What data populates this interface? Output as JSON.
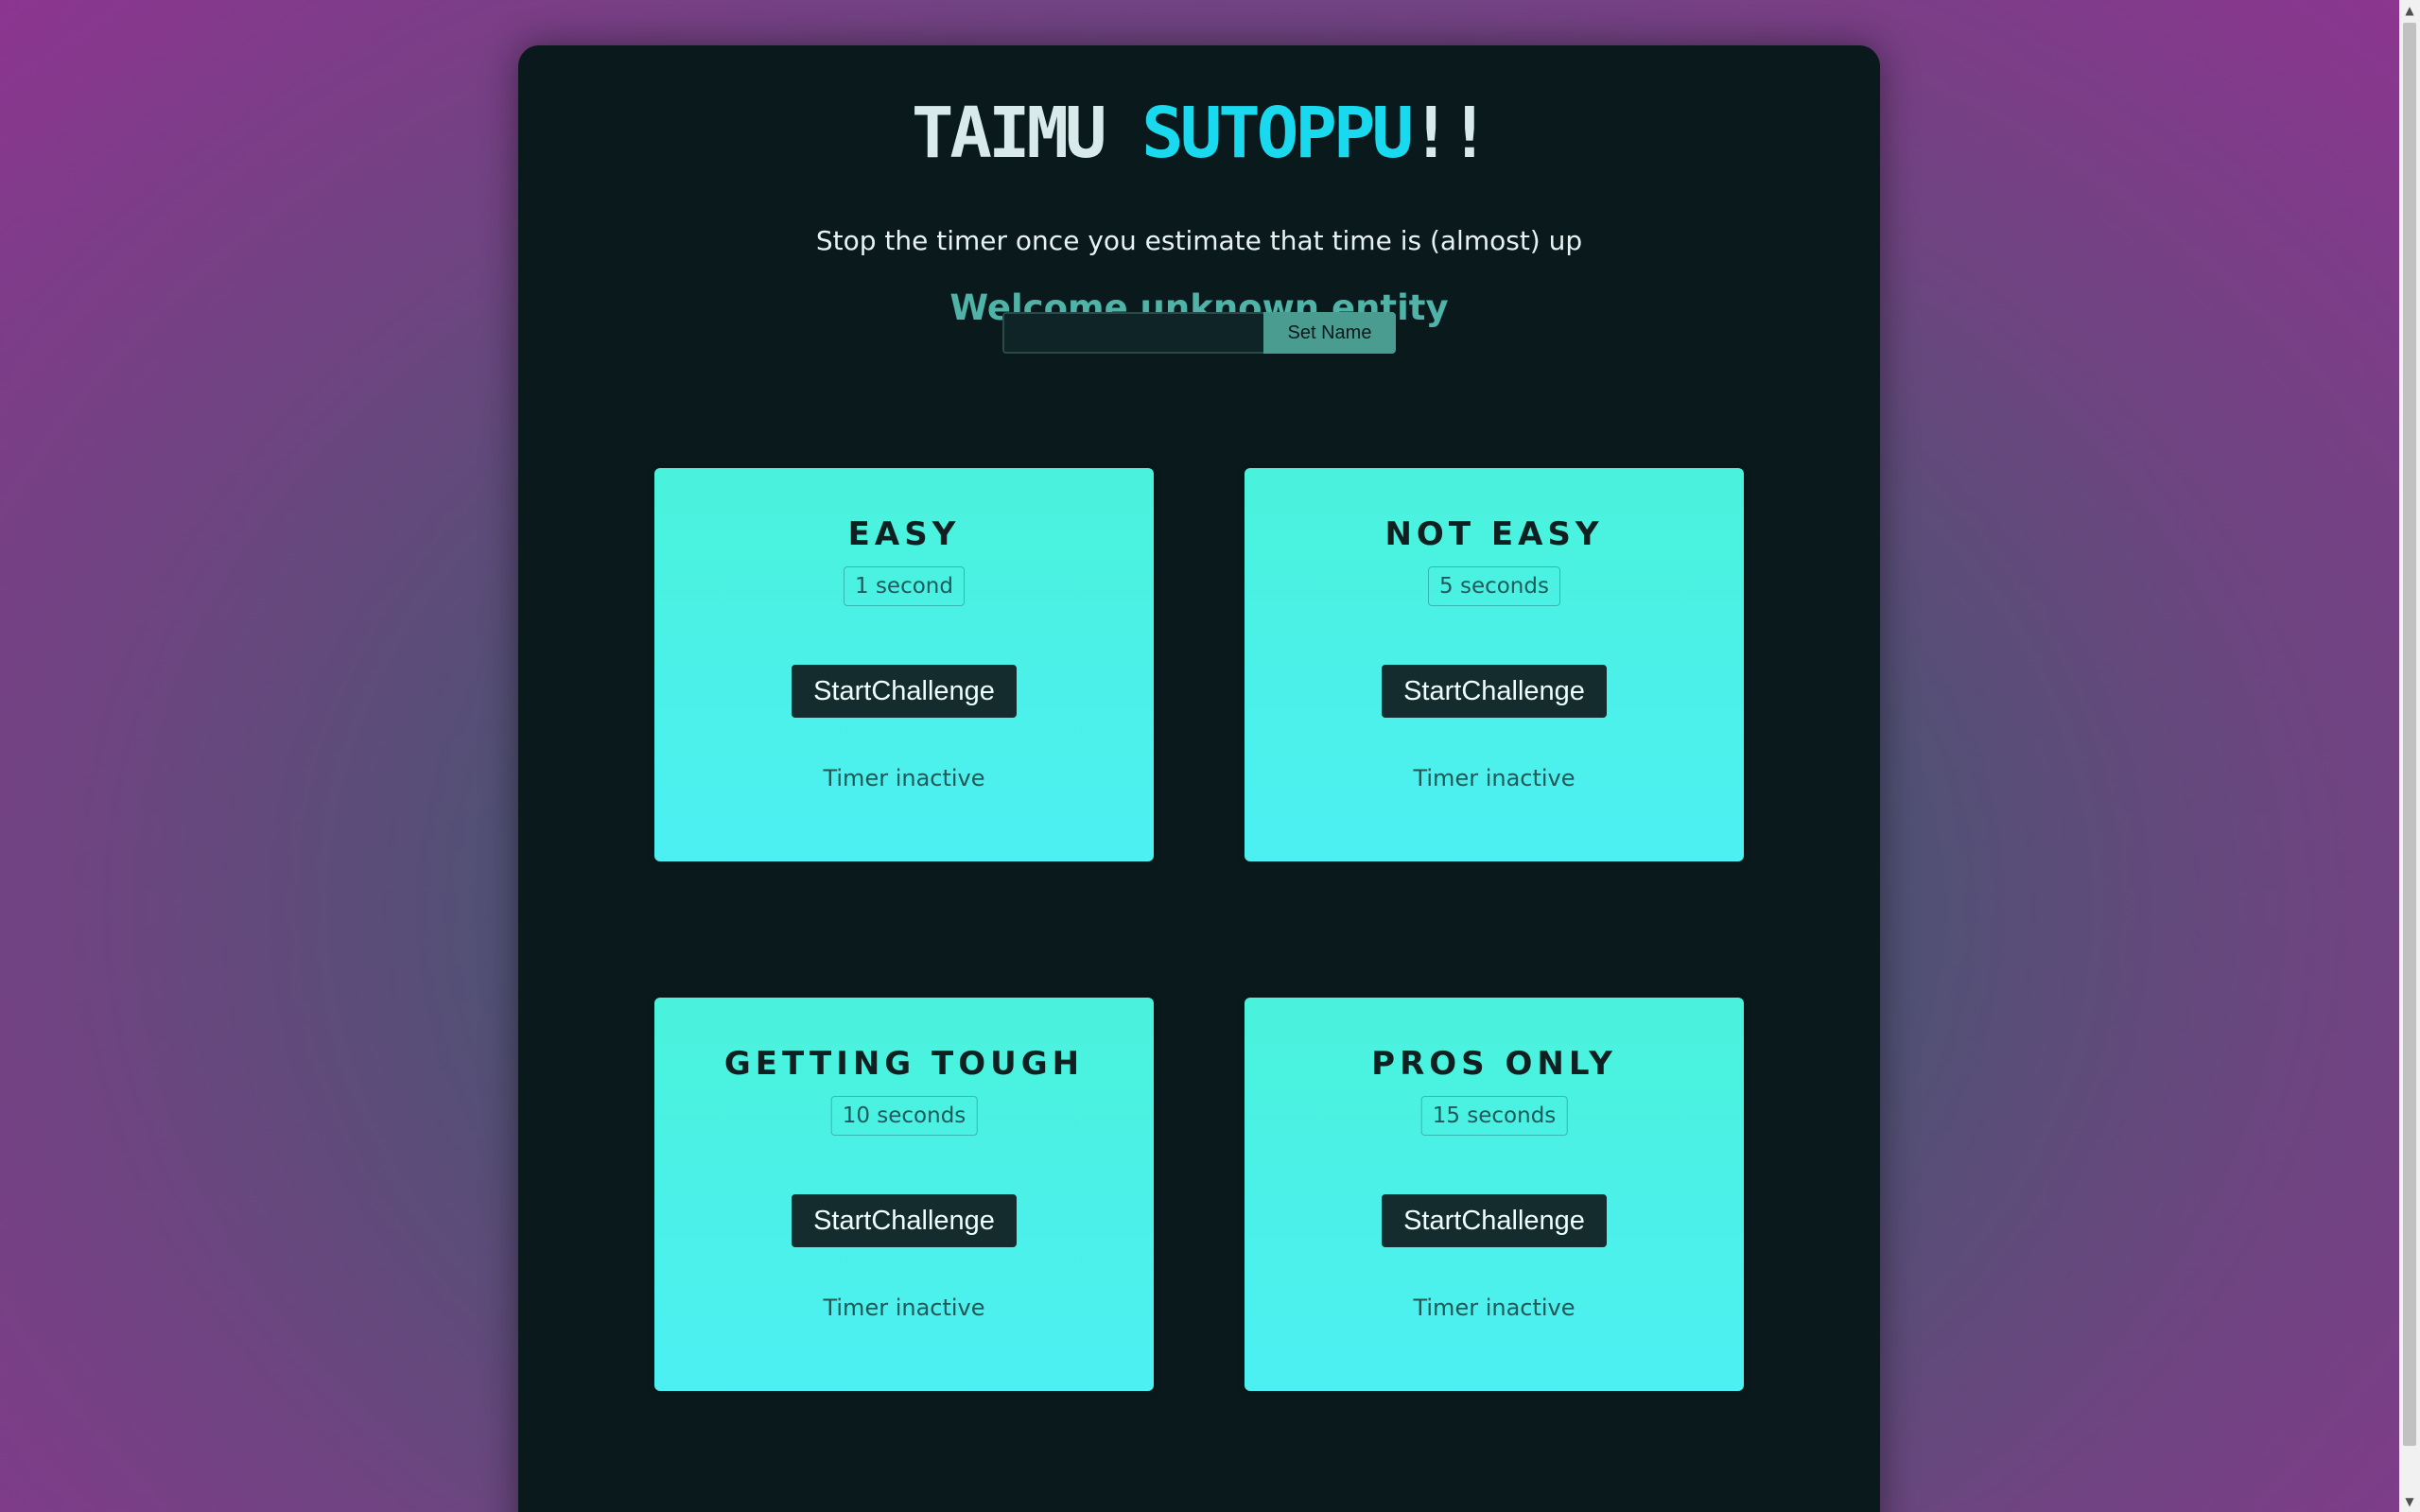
{
  "header": {
    "title_part1": "TAIMU ",
    "title_part2": "SUTOPPU",
    "title_part3": "!!",
    "subtitle": "Stop the timer once you estimate that time is (almost) up",
    "welcome": "Welcome unknown entity"
  },
  "name_form": {
    "input_value": "",
    "button_label": "Set Name"
  },
  "challenges": [
    {
      "title": "EASY",
      "duration": "1 second",
      "button": "StartChallenge",
      "status": "Timer inactive"
    },
    {
      "title": "NOT EASY",
      "duration": "5 seconds",
      "button": "StartChallenge",
      "status": "Timer inactive"
    },
    {
      "title": "GETTING TOUGH",
      "duration": "10 seconds",
      "button": "StartChallenge",
      "status": "Timer inactive"
    },
    {
      "title": "PROS ONLY",
      "duration": "15 seconds",
      "button": "StartChallenge",
      "status": "Timer inactive"
    }
  ],
  "colors": {
    "title_accent": "#18d9ee",
    "welcome": "#4fb3a7",
    "card_gradient_top": "#4af2dc",
    "card_gradient_bottom": "#4cf0f2",
    "button_bg": "#142c2e",
    "panel_bg": "#0a1a1c"
  }
}
